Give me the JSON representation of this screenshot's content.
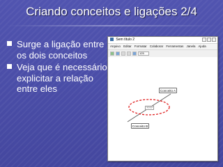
{
  "slide": {
    "title": "Criando conceitos e ligações 2/4",
    "bullets": [
      "Surge a ligação entre os dois conceitos",
      "Veja que é necessário explicitar a relação entre eles"
    ]
  },
  "window": {
    "title": "Sem título 2",
    "menu": [
      "Arquivo",
      "Editar",
      "Formatar",
      "Colaborar",
      "Ferramentas",
      "Janela",
      "Ajuda"
    ],
    "zoom": "125",
    "nodes": {
      "a": "Conceito A",
      "b": "Conceito B"
    },
    "link_label": "????",
    "highlight_color": "#e02020"
  },
  "colors": {
    "background": "#4a4da8",
    "text": "#ffffff"
  }
}
